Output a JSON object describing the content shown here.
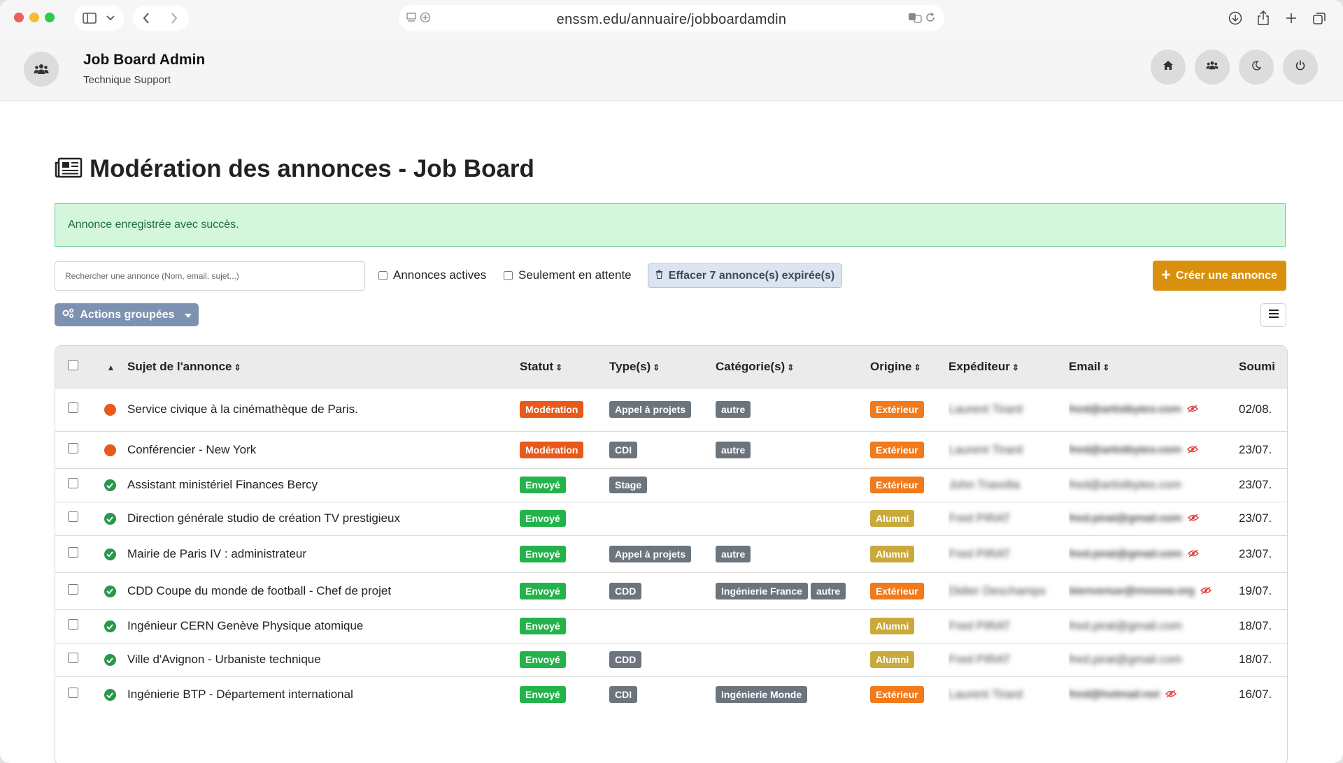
{
  "browser": {
    "url": "enssm.edu/annuaire/jobboardamdin",
    "icons": [
      "sidebar-icon",
      "chevron-down-icon",
      "back-icon",
      "forward-icon",
      "reader-icon",
      "add-tab-icon",
      "translate-icon",
      "reload-icon",
      "download-icon",
      "share-icon",
      "new-tab-icon",
      "tabs-icon"
    ]
  },
  "app": {
    "title": "Job Board Admin",
    "subtitle": "Technique Support",
    "header_buttons": [
      "home-icon",
      "users-icon",
      "moon-icon",
      "power-icon"
    ]
  },
  "page": {
    "title": "Modération des annonces - Job Board",
    "alert": "Annonce enregistrée avec succès."
  },
  "toolbar": {
    "search_placeholder": "Rechercher une annonce (Nom, email, sujet...)",
    "filter_active": "Annonces actives",
    "filter_pending": "Seulement en attente",
    "purge_label": "Effacer 7 annonce(s) expirée(s)",
    "create_label": "Créer une annonce",
    "bulk_label": "Actions groupées"
  },
  "colors": {
    "moderation": "#e8591a",
    "envoye": "#24b34b",
    "tag": "#6c757d",
    "exterieur": "#f07a1c",
    "alumni": "#c9a93b",
    "create": "#d9900c",
    "bulk": "#7d91b0"
  },
  "table": {
    "headers": {
      "sujet": "Sujet de l'annonce",
      "statut": "Statut",
      "types": "Type(s)",
      "categories": "Catégorie(s)",
      "origine": "Origine",
      "expediteur": "Expéditeur",
      "email": "Email",
      "soumis": "Soumi"
    },
    "rows": [
      {
        "state": "pending",
        "subject": "Service civique à la cinémathèque de Paris.",
        "status": "Modération",
        "types": [
          "Appel à projets"
        ],
        "categories": [
          "autre"
        ],
        "origin": "Extérieur",
        "sender": "Laurent Tirard",
        "email": "fred@artistbytes.com",
        "email_hidden": true,
        "date": "02/08."
      },
      {
        "state": "pending",
        "subject": "Conférencier - New York",
        "status": "Modération",
        "types": [
          "CDI"
        ],
        "categories": [
          "autre"
        ],
        "origin": "Extérieur",
        "sender": "Laurent Tirard",
        "email": "fred@artistbytes.com",
        "email_hidden": true,
        "date": "23/07."
      },
      {
        "state": "ok",
        "subject": "Assistant ministériel Finances Bercy",
        "status": "Envoyé",
        "types": [
          "Stage"
        ],
        "categories": [],
        "origin": "Extérieur",
        "sender": "John Travolta",
        "email": "fred@artistbytes.com",
        "email_hidden": false,
        "date": "23/07."
      },
      {
        "state": "ok",
        "subject": "Direction générale studio de création TV prestigieux",
        "status": "Envoyé",
        "types": [],
        "categories": [],
        "origin": "Alumni",
        "sender": "Fred PIRAT",
        "email": "fred.pirat@gmail.com",
        "email_hidden": true,
        "date": "23/07."
      },
      {
        "state": "ok",
        "subject": "Mairie de Paris IV : administrateur",
        "status": "Envoyé",
        "types": [
          "Appel à projets"
        ],
        "categories": [
          "autre"
        ],
        "origin": "Alumni",
        "sender": "Fred PIRAT",
        "email": "fred.pirat@gmail.com",
        "email_hidden": true,
        "date": "23/07."
      },
      {
        "state": "ok",
        "subject": "CDD Coupe du monde de football - Chef de projet",
        "status": "Envoyé",
        "types": [
          "CDD"
        ],
        "categories": [
          "Ingénierie France",
          "autre"
        ],
        "origin": "Extérieur",
        "sender": "Didier Deschamps",
        "email": "bienvenue@moowa.org",
        "email_hidden": true,
        "date": "19/07."
      },
      {
        "state": "ok",
        "subject": "Ingénieur CERN Genève Physique atomique",
        "status": "Envoyé",
        "types": [],
        "categories": [],
        "origin": "Alumni",
        "sender": "Fred PIRAT",
        "email": "fred.pirat@gmail.com",
        "email_hidden": false,
        "date": "18/07."
      },
      {
        "state": "ok",
        "subject": "Ville d'Avignon - Urbaniste technique",
        "status": "Envoyé",
        "types": [
          "CDD"
        ],
        "categories": [],
        "origin": "Alumni",
        "sender": "Fred PIRAT",
        "email": "fred.pirat@gmail.com",
        "email_hidden": false,
        "date": "18/07."
      },
      {
        "state": "ok",
        "subject": "Ingénierie BTP - Département international",
        "status": "Envoyé",
        "types": [
          "CDI"
        ],
        "categories": [
          "Ingénierie Monde"
        ],
        "origin": "Extérieur",
        "sender": "Laurent Tirard",
        "email": "fred@hotmail.net",
        "email_hidden": true,
        "date": "16/07."
      }
    ]
  }
}
